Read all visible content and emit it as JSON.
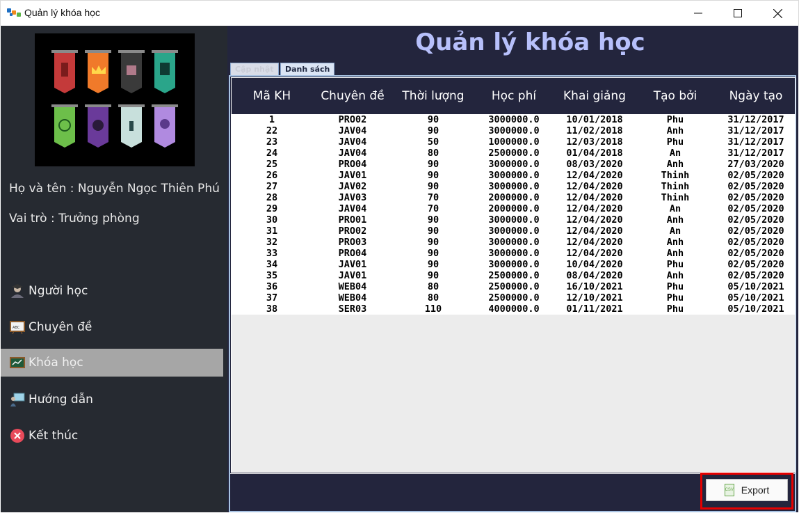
{
  "window": {
    "title": "Quản lý khóa học"
  },
  "sidebar": {
    "profile_name": "Họ và tên : Nguyễn Ngọc Thiên Phú",
    "profile_role": "Vai trò : Trưởng phòng",
    "items": [
      {
        "label": "Người học",
        "icon": "student-icon"
      },
      {
        "label": "Chuyên đề",
        "icon": "board-icon"
      },
      {
        "label": "Khóa học",
        "icon": "chart-board-icon",
        "active": true
      },
      {
        "label": "Hướng dẫn",
        "icon": "presenter-icon"
      },
      {
        "label": "Kết thúc",
        "icon": "close-circle-icon"
      }
    ]
  },
  "main": {
    "page_title": "Quản lý khóa học",
    "tabs": [
      {
        "label": "Cập nhật"
      },
      {
        "label": "Danh sách"
      }
    ],
    "columns": [
      "Mã KH",
      "Chuyên đề",
      "Thời lượng",
      "Học phí",
      "Khai giảng",
      "Tạo bởi",
      "Ngày tạo"
    ],
    "rows": [
      [
        "1",
        "PRO02",
        "90",
        "3000000.0",
        "10/01/2018",
        "Phu",
        "31/12/2017"
      ],
      [
        "22",
        "JAV04",
        "90",
        "3000000.0",
        "11/02/2018",
        "Anh",
        "31/12/2017"
      ],
      [
        "23",
        "JAV04",
        "50",
        "1000000.0",
        "12/03/2018",
        "Phu",
        "31/12/2017"
      ],
      [
        "24",
        "JAV04",
        "80",
        "2500000.0",
        "01/04/2018",
        "An",
        "31/12/2017"
      ],
      [
        "25",
        "PRO04",
        "90",
        "3000000.0",
        "08/03/2020",
        "Anh",
        "27/03/2020"
      ],
      [
        "26",
        "JAV01",
        "90",
        "3000000.0",
        "12/04/2020",
        "Thinh",
        "02/05/2020"
      ],
      [
        "27",
        "JAV02",
        "90",
        "3000000.0",
        "12/04/2020",
        "Thinh",
        "02/05/2020"
      ],
      [
        "28",
        "JAV03",
        "70",
        "2000000.0",
        "12/04/2020",
        "Thinh",
        "02/05/2020"
      ],
      [
        "29",
        "JAV04",
        "70",
        "2000000.0",
        "12/04/2020",
        "An",
        "02/05/2020"
      ],
      [
        "30",
        "PRO01",
        "90",
        "3000000.0",
        "12/04/2020",
        "Anh",
        "02/05/2020"
      ],
      [
        "31",
        "PRO02",
        "90",
        "3000000.0",
        "12/04/2020",
        "An",
        "02/05/2020"
      ],
      [
        "32",
        "PRO03",
        "90",
        "3000000.0",
        "12/04/2020",
        "Anh",
        "02/05/2020"
      ],
      [
        "33",
        "PRO04",
        "90",
        "3000000.0",
        "12/04/2020",
        "Anh",
        "02/05/2020"
      ],
      [
        "34",
        "JAV01",
        "90",
        "3000000.0",
        "10/04/2020",
        "Phu",
        "02/05/2020"
      ],
      [
        "35",
        "JAV01",
        "90",
        "2500000.0",
        "08/04/2020",
        "Anh",
        "02/05/2020"
      ],
      [
        "36",
        "WEB04",
        "80",
        "2500000.0",
        "16/10/2021",
        "Phu",
        "05/10/2021"
      ],
      [
        "37",
        "WEB04",
        "80",
        "2500000.0",
        "12/10/2021",
        "Phu",
        "05/10/2021"
      ],
      [
        "38",
        "SER03",
        "110",
        "4000000.0",
        "01/11/2021",
        "Phu",
        "05/10/2021"
      ]
    ],
    "export_label": "Export",
    "export_icon_text": "CSV"
  },
  "colors": {
    "sidebar_bg": "#262a31",
    "main_bg": "#23253d",
    "title_color": "#b7c0fb",
    "active_item_bg": "#a6a6a6",
    "highlight": "#e60000"
  }
}
